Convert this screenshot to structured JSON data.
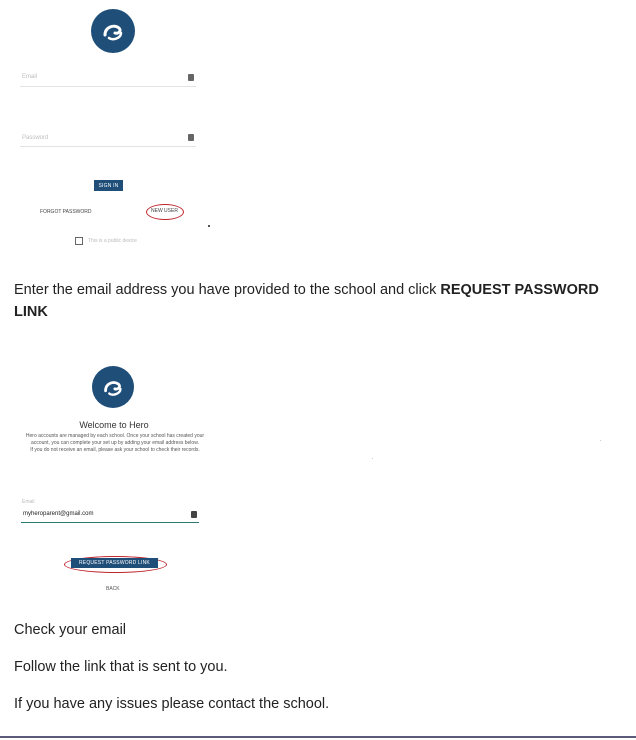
{
  "screen1": {
    "email_placeholder": "Email",
    "password_placeholder": "Password",
    "sign_in_label": "SIGN IN",
    "forgot_password_label": "FORGOT PASSWORD",
    "new_user_label": "NEW USER",
    "public_device_label": "This is a public device"
  },
  "instruction1": {
    "prefix": "Enter the email address you have provided to the school and click ",
    "bold": "REQUEST PASSWORD LINK"
  },
  "screen2": {
    "title": "Welcome to Hero",
    "description_1": "Hero accounts are managed by each school. Once your school has created your account, you can complete your set up by adding your email address below.",
    "description_2": "If you do not receive an email, please ask your school to check their records.",
    "email_label": "Email",
    "email_value": "myheroparent@gmail.com",
    "request_button_label": "REQUEST PASSWORD LINK",
    "back_label": "BACK"
  },
  "steps": [
    "Check your email",
    "Follow the link that is sent to you.",
    "If you have any issues please contact the school."
  ],
  "colors": {
    "brand": "#1f4e79",
    "highlight_ring": "#c0262d"
  }
}
